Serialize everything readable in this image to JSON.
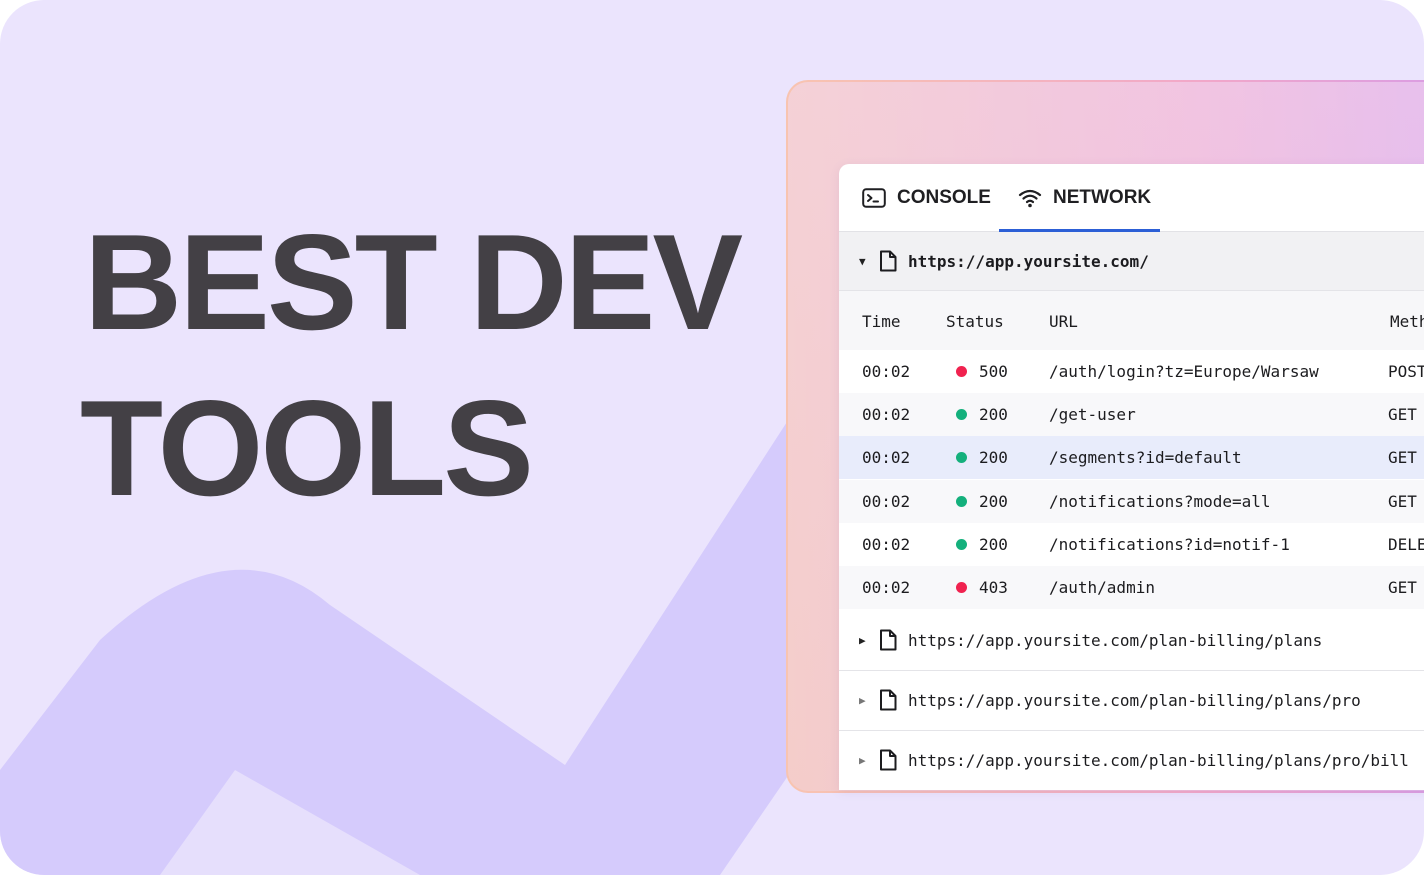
{
  "headline": {
    "line1": "BEST DEV",
    "line2": "TOOLS"
  },
  "tabs": [
    {
      "label": "CONSOLE",
      "icon": "terminal-icon",
      "active": false
    },
    {
      "label": "NETWORK",
      "icon": "wifi-icon",
      "active": true
    }
  ],
  "network": {
    "open_group": {
      "url": "https://app.yoursite.com/",
      "expanded": true
    },
    "columns": [
      "Time",
      "Status",
      "URL",
      "Meth"
    ],
    "rows": [
      {
        "time": "00:02",
        "status": "500",
        "status_color": "#f0224f",
        "url": "/auth/login?tz=Europe/Warsaw",
        "method": "POST"
      },
      {
        "time": "00:02",
        "status": "200",
        "status_color": "#14b07c",
        "url": "/get-user",
        "method": "GET"
      },
      {
        "time": "00:02",
        "status": "200",
        "status_color": "#14b07c",
        "url": "/segments?id=default",
        "method": "GET",
        "selected": true
      },
      {
        "time": "00:02",
        "status": "200",
        "status_color": "#14b07c",
        "url": "/notifications?mode=all",
        "method": "GET"
      },
      {
        "time": "00:02",
        "status": "200",
        "status_color": "#14b07c",
        "url": "/notifications?id=notif-1",
        "method": "DELE"
      },
      {
        "time": "00:02",
        "status": "403",
        "status_color": "#f0224f",
        "url": "/auth/admin",
        "method": "GET"
      }
    ],
    "collapsed_groups": [
      {
        "url": "https://app.yoursite.com/plan-billing/plans"
      },
      {
        "url": "https://app.yoursite.com/plan-billing/plans/pro"
      },
      {
        "url": "https://app.yoursite.com/plan-billing/plans/pro/bill"
      }
    ]
  },
  "colors": {
    "background": "#ebe4fd",
    "shape": "#d5cbfc",
    "headline": "#434045",
    "tab_underline": "#2c5fd6",
    "selected_row": "#e8ecfb"
  }
}
